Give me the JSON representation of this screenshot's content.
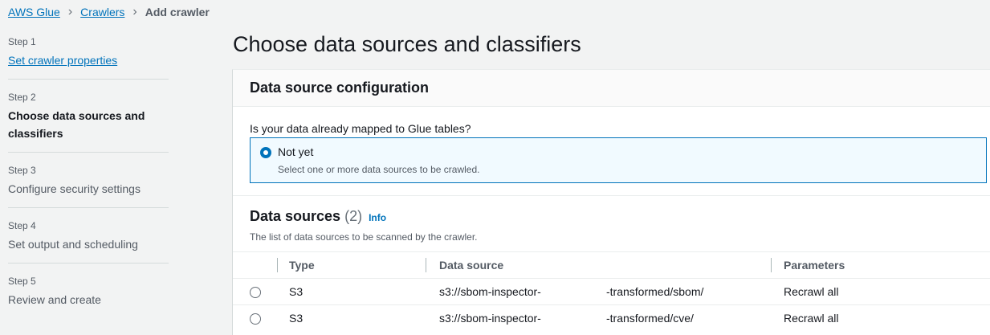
{
  "breadcrumb": {
    "items": [
      "AWS Glue",
      "Crawlers"
    ],
    "current": "Add crawler"
  },
  "steps": [
    {
      "num": "Step 1",
      "title": "Set crawler properties",
      "state": "link"
    },
    {
      "num": "Step 2",
      "title": "Choose data sources and classifiers",
      "state": "active"
    },
    {
      "num": "Step 3",
      "title": "Configure security settings",
      "state": "disabled"
    },
    {
      "num": "Step 4",
      "title": "Set output and scheduling",
      "state": "disabled"
    },
    {
      "num": "Step 5",
      "title": "Review and create",
      "state": "disabled"
    }
  ],
  "page_title": "Choose data sources and classifiers",
  "config": {
    "title": "Data source configuration",
    "question": "Is your data already mapped to Glue tables?",
    "option_label": "Not yet",
    "option_desc": "Select one or more data sources to be crawled.",
    "selected": true
  },
  "sources": {
    "title": "Data sources",
    "count": "(2)",
    "info": "Info",
    "description": "The list of data sources to be scanned by the crawler.",
    "columns": [
      "Type",
      "Data source",
      "Parameters"
    ],
    "rows": [
      {
        "type": "S3",
        "source_prefix": "s3://sbom-inspector-",
        "source_suffix": "-transformed/sbom/",
        "parameters": "Recrawl all"
      },
      {
        "type": "S3",
        "source_prefix": "s3://sbom-inspector-",
        "source_suffix": "-transformed/cve/",
        "parameters": "Recrawl all"
      }
    ]
  }
}
